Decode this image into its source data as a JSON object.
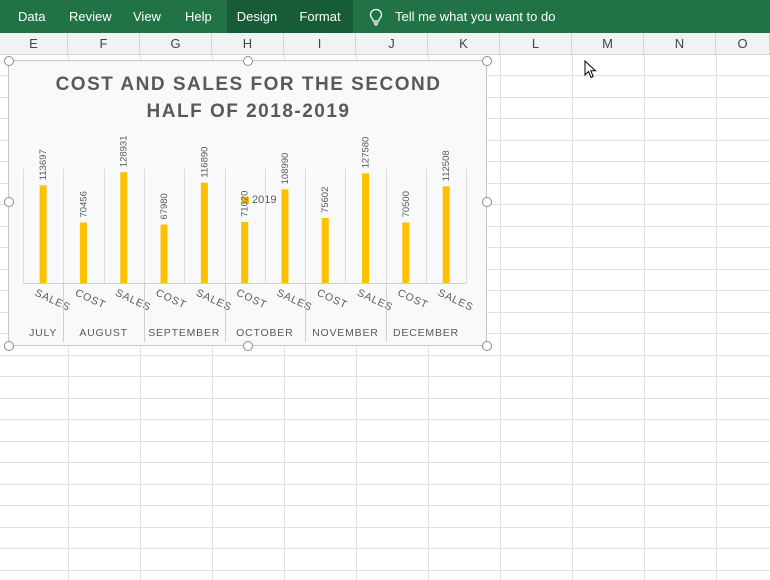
{
  "ribbon": {
    "tabs": [
      "Data",
      "Review",
      "View",
      "Help",
      "Design",
      "Format"
    ],
    "tell_me": "Tell me what you want to do"
  },
  "columns": [
    "E",
    "F",
    "G",
    "H",
    "I",
    "J",
    "K",
    "L",
    "M",
    "N",
    "O"
  ],
  "colors": {
    "ribbon": "#217346",
    "ribbon_context_tab": "#185c37",
    "bar": "#ffc000",
    "title": "#595959"
  },
  "chart_data": {
    "type": "bar",
    "title": [
      "COST AND SALES FOR THE SECOND",
      "HALF OF 2018-2019"
    ],
    "legend": {
      "position": "top",
      "entries": [
        "2019"
      ]
    },
    "groups": [
      "JULY",
      "AUGUST",
      "SEPTEMBER",
      "OCTOBER",
      "NOVEMBER",
      "DECEMBER"
    ],
    "categories": [
      {
        "group": "JULY",
        "label": "SALES"
      },
      {
        "group": "AUGUST",
        "label": "COST"
      },
      {
        "group": "AUGUST",
        "label": "SALES"
      },
      {
        "group": "SEPTEMBER",
        "label": "COST"
      },
      {
        "group": "SEPTEMBER",
        "label": "SALES"
      },
      {
        "group": "OCTOBER",
        "label": "COST"
      },
      {
        "group": "OCTOBER",
        "label": "SALES"
      },
      {
        "group": "NOVEMBER",
        "label": "COST"
      },
      {
        "group": "NOVEMBER",
        "label": "SALES"
      },
      {
        "group": "DECEMBER",
        "label": "COST"
      },
      {
        "group": "DECEMBER",
        "label": "SALES"
      }
    ],
    "series": [
      {
        "name": "2019",
        "values": [
          113697,
          70456,
          128931,
          67980,
          116890,
          71020,
          108990,
          75602,
          127580,
          70500,
          112508
        ]
      }
    ],
    "data_labels": true,
    "gridlines": "vertical"
  }
}
